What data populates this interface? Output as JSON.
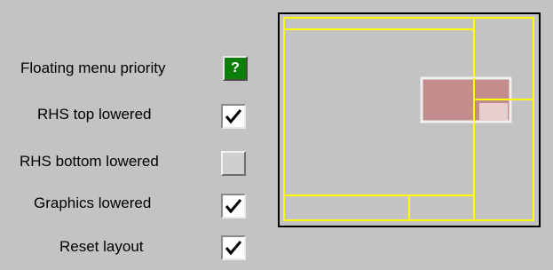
{
  "options": [
    {
      "label": "Floating menu priority",
      "control": "help",
      "glyph": "?"
    },
    {
      "label": "RHS top lowered",
      "control": "checkbox",
      "checked": true
    },
    {
      "label": "RHS bottom lowered",
      "control": "checkbox",
      "checked": false
    },
    {
      "label": "Graphics lowered",
      "control": "checkbox",
      "checked": true
    },
    {
      "label": "Reset layout",
      "control": "checkbox",
      "checked": true
    }
  ],
  "colors": {
    "background": "#c3c3c3",
    "help_button": "#0a7f0a",
    "layout_lines": "#ffff00",
    "floating_menu": "#c38d8d",
    "floating_menu_border": "#f0f0f0"
  }
}
